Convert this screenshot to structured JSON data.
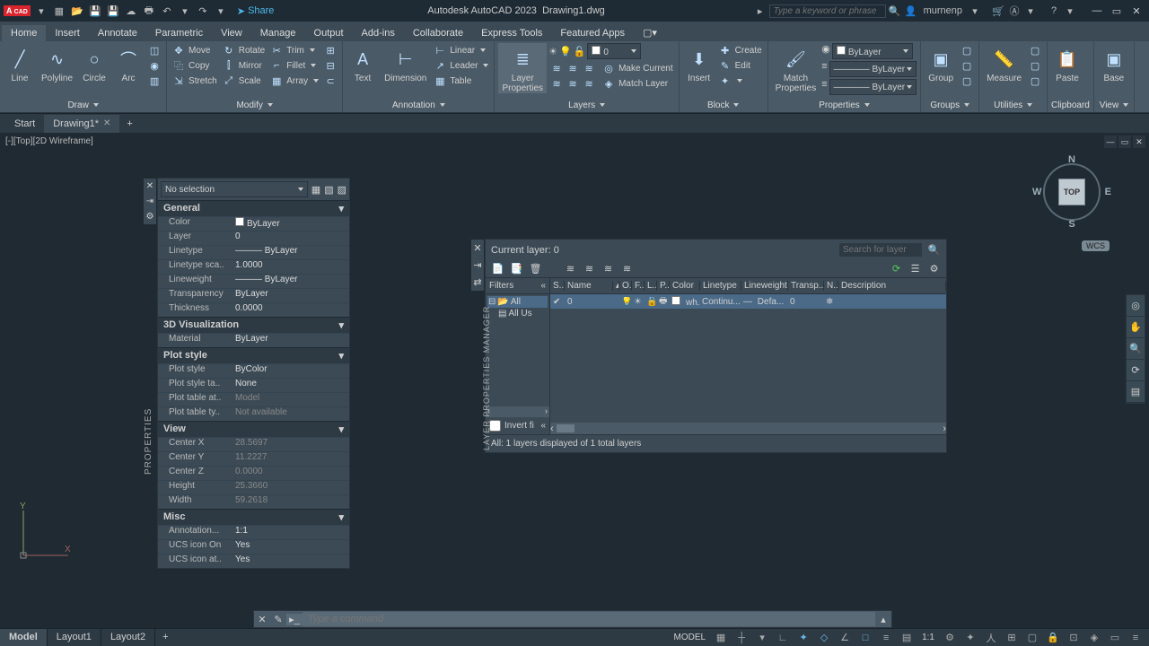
{
  "title": {
    "app": "Autodesk AutoCAD 2023",
    "file": "Drawing1.dwg"
  },
  "quick": {
    "share": "Share"
  },
  "search_placeholder": "Type a keyword or phrase",
  "user": "murnenp",
  "menu": {
    "tabs": [
      "Home",
      "Insert",
      "Annotate",
      "Parametric",
      "View",
      "Manage",
      "Output",
      "Add-ins",
      "Collaborate",
      "Express Tools",
      "Featured Apps"
    ],
    "active": 0
  },
  "ribbon": {
    "draw": {
      "title": "Draw",
      "line": "Line",
      "polyline": "Polyline",
      "circle": "Circle",
      "arc": "Arc"
    },
    "modify": {
      "title": "Modify",
      "move": "Move",
      "copy": "Copy",
      "stretch": "Stretch",
      "rotate": "Rotate",
      "mirror": "Mirror",
      "scale": "Scale",
      "trim": "Trim",
      "fillet": "Fillet",
      "array": "Array"
    },
    "annotation": {
      "title": "Annotation",
      "text": "Text",
      "dimension": "Dimension",
      "linear": "Linear",
      "leader": "Leader",
      "table": "Table"
    },
    "layers": {
      "title": "Layers",
      "props": "Layer\nProperties",
      "current_layer": "0",
      "make_current": "Make Current",
      "match_layer": "Match Layer"
    },
    "block": {
      "title": "Block",
      "insert": "Insert",
      "create": "Create",
      "edit": "Edit"
    },
    "properties": {
      "title": "Properties",
      "match": "Match\nProperties",
      "bylayer": "ByLayer"
    },
    "groups": {
      "title": "Groups",
      "group": "Group"
    },
    "utilities": {
      "title": "Utilities",
      "measure": "Measure"
    },
    "clipboard": {
      "title": "Clipboard",
      "paste": "Paste"
    },
    "view": {
      "title": "View",
      "base": "Base"
    }
  },
  "filetabs": {
    "start": "Start",
    "drawing": "Drawing1*"
  },
  "viewport": {
    "label": "[-][Top][2D Wireframe]",
    "cube": "TOP",
    "wcs": "WCS"
  },
  "properties": {
    "title": "PROPERTIES",
    "selection": "No selection",
    "sections": {
      "general": "General",
      "viz": "3D Visualization",
      "plot": "Plot style",
      "view": "View",
      "misc": "Misc"
    },
    "rows": {
      "color_k": "Color",
      "color_v": "ByLayer",
      "layer_k": "Layer",
      "layer_v": "0",
      "ltype_k": "Linetype",
      "ltype_v": "ByLayer",
      "ltscale_k": "Linetype sca..",
      "ltscale_v": "1.0000",
      "lweight_k": "Lineweight",
      "lweight_v": "ByLayer",
      "transp_k": "Transparency",
      "transp_v": "ByLayer",
      "thick_k": "Thickness",
      "thick_v": "0.0000",
      "material_k": "Material",
      "material_v": "ByLayer",
      "pstyle_k": "Plot style",
      "pstyle_v": "ByColor",
      "pstyletab_k": "Plot style ta..",
      "pstyletab_v": "None",
      "ptableat_k": "Plot table at..",
      "ptableat_v": "Model",
      "ptablety_k": "Plot table ty..",
      "ptablety_v": "Not available",
      "cx_k": "Center X",
      "cx_v": "28.5697",
      "cy_k": "Center Y",
      "cy_v": "11.2227",
      "cz_k": "Center Z",
      "cz_v": "0.0000",
      "h_k": "Height",
      "h_v": "25.3660",
      "w_k": "Width",
      "w_v": "59.2618",
      "anno_k": "Annotation...",
      "anno_v": "1:1",
      "ucsicon_k": "UCS icon On",
      "ucsicon_v": "Yes",
      "ucsat_k": "UCS icon at..",
      "ucsat_v": "Yes"
    }
  },
  "layerpal": {
    "title": "LAYER PROPERTIES MANAGER",
    "current": "Current layer: 0",
    "search_placeholder": "Search for layer",
    "filters_label": "Filters",
    "all": "All",
    "all_used": "All Us",
    "invert": "Invert fi",
    "cols": {
      "status": "S..",
      "name": "Name",
      "on": "O..",
      "freeze": "F..",
      "lock": "L..",
      "plot": "P..",
      "color": "Color",
      "linetype": "Linetype",
      "lineweight": "Lineweight",
      "transp": "Transp...",
      "new": "N..",
      "desc": "Description"
    },
    "row0": {
      "name": "0",
      "color": "wh...",
      "linetype": "Continu...",
      "lineweight": "Defa...",
      "transp": "0"
    },
    "status": "All: 1 layers displayed of 1 total layers"
  },
  "cmd": {
    "placeholder": "Type a command"
  },
  "status": {
    "layouts": [
      "Model",
      "Layout1",
      "Layout2"
    ],
    "model_label": "MODEL",
    "scale": "1:1"
  }
}
